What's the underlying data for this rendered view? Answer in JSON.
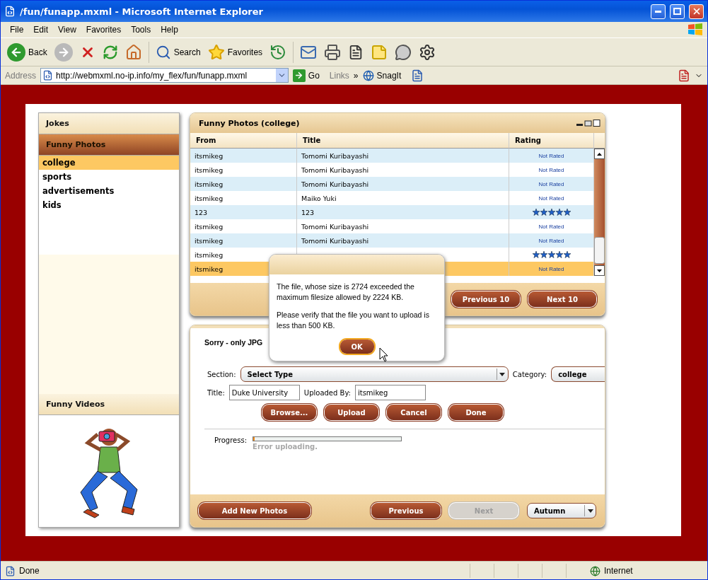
{
  "window": {
    "title": "/fun/funapp.mxml - Microsoft Internet Explorer"
  },
  "menu": [
    "File",
    "Edit",
    "View",
    "Favorites",
    "Tools",
    "Help"
  ],
  "toolbar": [
    {
      "kind": "back",
      "label": "Back"
    },
    {
      "kind": "forward"
    },
    {
      "kind": "stop"
    },
    {
      "kind": "refresh"
    },
    {
      "kind": "home"
    },
    {
      "kind": "search",
      "label": "Search"
    },
    {
      "kind": "favorites",
      "label": "Favorites"
    },
    {
      "kind": "history"
    },
    {
      "kind": "mail"
    },
    {
      "kind": "print"
    },
    {
      "kind": "edit"
    },
    {
      "kind": "note"
    },
    {
      "kind": "messenger"
    },
    {
      "kind": "gear"
    }
  ],
  "address": {
    "label": "Address",
    "url": "http://webmxml.no-ip.info/my_flex/fun/funapp.mxml",
    "go": "Go",
    "links": "Links",
    "more": "»",
    "snagit": "SnagIt"
  },
  "sidebar": {
    "sections": [
      {
        "title": "Jokes",
        "expanded": false
      },
      {
        "title": "Funny Photos",
        "expanded": true,
        "items": [
          {
            "label": "college",
            "selected": true
          },
          {
            "label": "sports",
            "selected": false
          },
          {
            "label": "advertisements",
            "selected": false
          },
          {
            "label": "kids",
            "selected": false
          }
        ]
      },
      {
        "title": "Funny Videos",
        "expanded": false
      }
    ]
  },
  "photo_grid": {
    "title": "Funny Photos (college)",
    "columns": [
      "From",
      "Title",
      "Rating"
    ],
    "rows": [
      {
        "kind": "text",
        "from": "itsmikeg",
        "title": "Tomomi Kuribayashi",
        "rating": "Not Rated",
        "selected": false
      },
      {
        "kind": "text",
        "from": "itsmikeg",
        "title": "Tomomi Kuribayashi",
        "rating": "Not Rated",
        "selected": false
      },
      {
        "kind": "text",
        "from": "itsmikeg",
        "title": "Tomomi Kuribayashi",
        "rating": "Not Rated",
        "selected": false
      },
      {
        "kind": "text",
        "from": "itsmikeg",
        "title": "Maiko Yuki",
        "rating": "Not Rated",
        "selected": false
      },
      {
        "kind": "stars",
        "from": "123",
        "title": "123",
        "stars": 5,
        "selected": false
      },
      {
        "kind": "text",
        "from": "itsmikeg",
        "title": "Tomomi Kuribayashi",
        "rating": "Not Rated",
        "selected": false
      },
      {
        "kind": "text",
        "from": "itsmikeg",
        "title": "Tomomi Kuribayashi",
        "rating": "Not Rated",
        "selected": false
      },
      {
        "kind": "stars",
        "from": "itsmikeg",
        "stars": 5,
        "selected": false
      },
      {
        "kind": "text",
        "from": "itsmikeg",
        "rating": "Not Rated",
        "selected": true
      }
    ],
    "buttons": [
      "Previous 10",
      "Next 10"
    ]
  },
  "upload": {
    "message": "Sorry - only JPG",
    "section": {
      "label": "Section:",
      "value": "Select Type"
    },
    "category": {
      "label": "Category:",
      "value": "college"
    },
    "title": {
      "label": "Title:",
      "value": "Duke University"
    },
    "uploaded_by": {
      "label": "Uploaded By:",
      "value": "itsmikeg"
    },
    "buttons": [
      "Browse...",
      "Upload",
      "Cancel",
      "Done"
    ],
    "progress": {
      "label": "Progress:",
      "level": 0.01,
      "status": "Error uploading."
    }
  },
  "footer": {
    "buttons": [
      {
        "label": "Add New Photos",
        "disabled": false
      },
      {
        "label": "Previous",
        "disabled": false
      },
      {
        "label": "Next",
        "disabled": true
      }
    ],
    "theme": "Autumn"
  },
  "dialog": {
    "paragraphs": [
      "The file, whose size is 2724 exceeded the maximum filesize allowed by 2224 KB.",
      "Please verify that the file you want to upload is less than 500 KB."
    ],
    "button": "OK"
  },
  "status_bar": {
    "text": "Done",
    "zone": "Internet"
  }
}
